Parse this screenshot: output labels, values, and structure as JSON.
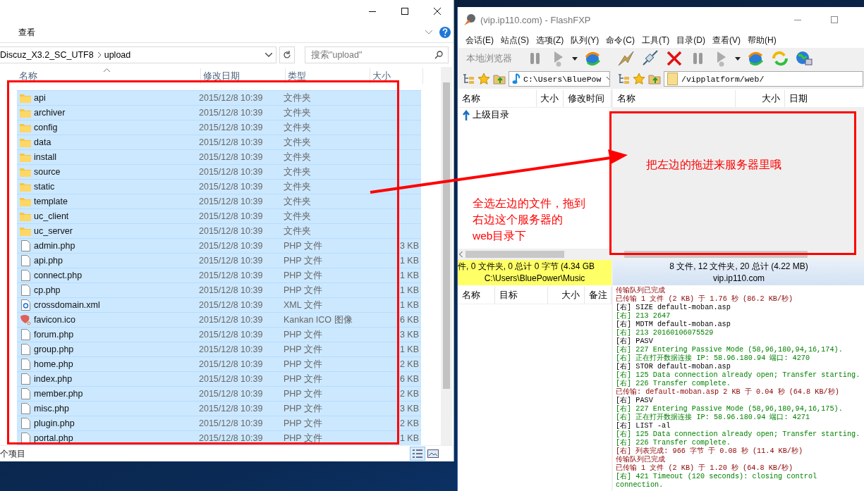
{
  "explorer": {
    "ribbon_tab": "查看",
    "breadcrumb": [
      "Discuz_X3.2_SC_UTF8",
      "upload"
    ],
    "search": {
      "placeholder": "搜索\"upload\""
    },
    "columns": [
      "名称",
      "修改日期",
      "类型",
      "大小"
    ],
    "rows": [
      {
        "name": "api",
        "date": "2015/12/8 10:39",
        "type": "文件夹",
        "kind": "folder",
        "selected": true
      },
      {
        "name": "archiver",
        "date": "2015/12/8 10:39",
        "type": "文件夹",
        "kind": "folder",
        "selected": true
      },
      {
        "name": "config",
        "date": "2015/12/8 10:39",
        "type": "文件夹",
        "kind": "folder",
        "selected": true
      },
      {
        "name": "data",
        "date": "2015/12/8 10:39",
        "type": "文件夹",
        "kind": "folder",
        "selected": true
      },
      {
        "name": "install",
        "date": "2015/12/8 10:39",
        "type": "文件夹",
        "kind": "folder",
        "selected": true
      },
      {
        "name": "source",
        "date": "2015/12/8 10:39",
        "type": "文件夹",
        "kind": "folder",
        "selected": true
      },
      {
        "name": "static",
        "date": "2015/12/8 10:39",
        "type": "文件夹",
        "kind": "folder",
        "selected": true
      },
      {
        "name": "template",
        "date": "2015/12/8 10:39",
        "type": "文件夹",
        "kind": "folder",
        "selected": true
      },
      {
        "name": "uc_client",
        "date": "2015/12/8 10:39",
        "type": "文件夹",
        "kind": "folder",
        "selected": true
      },
      {
        "name": "uc_server",
        "date": "2015/12/8 10:39",
        "type": "文件夹",
        "kind": "folder",
        "selected": true
      },
      {
        "name": "admin.php",
        "date": "2015/12/8 10:39",
        "type": "PHP 文件",
        "size": "3 KB",
        "kind": "file",
        "selected": true
      },
      {
        "name": "api.php",
        "date": "2015/12/8 10:39",
        "type": "PHP 文件",
        "size": "1 KB",
        "kind": "file",
        "selected": true
      },
      {
        "name": "connect.php",
        "date": "2015/12/8 10:39",
        "type": "PHP 文件",
        "size": "1 KB",
        "kind": "file",
        "selected": true
      },
      {
        "name": "cp.php",
        "date": "2015/12/8 10:39",
        "type": "PHP 文件",
        "size": "1 KB",
        "kind": "file",
        "selected": true
      },
      {
        "name": "crossdomain.xml",
        "date": "2015/12/8 10:39",
        "type": "XML 文件",
        "size": "1 KB",
        "kind": "xml",
        "selected": true
      },
      {
        "name": "favicon.ico",
        "date": "2015/12/8 10:39",
        "type": "Kankan ICO 图像",
        "size": "6 KB",
        "kind": "image",
        "selected": true
      },
      {
        "name": "forum.php",
        "date": "2015/12/8 10:39",
        "type": "PHP 文件",
        "size": "3 KB",
        "kind": "file",
        "selected": true
      },
      {
        "name": "group.php",
        "date": "2015/12/8 10:39",
        "type": "PHP 文件",
        "size": "1 KB",
        "kind": "file",
        "selected": true
      },
      {
        "name": "home.php",
        "date": "2015/12/8 10:39",
        "type": "PHP 文件",
        "size": "2 KB",
        "kind": "file",
        "selected": true
      },
      {
        "name": "index.php",
        "date": "2015/12/8 10:39",
        "type": "PHP 文件",
        "size": "6 KB",
        "kind": "file",
        "selected": true
      },
      {
        "name": "member.php",
        "date": "2015/12/8 10:39",
        "type": "PHP 文件",
        "size": "2 KB",
        "kind": "file",
        "selected": true
      },
      {
        "name": "misc.php",
        "date": "2015/12/8 10:39",
        "type": "PHP 文件",
        "size": "3 KB",
        "kind": "file",
        "selected": true
      },
      {
        "name": "plugin.php",
        "date": "2015/12/8 10:39",
        "type": "PHP 文件",
        "size": "2 KB",
        "kind": "file",
        "selected": true
      },
      {
        "name": "portal.php",
        "date": "2015/12/8 10:39",
        "type": "PHP 文件",
        "size": "1 KB",
        "kind": "file",
        "selected": true
      }
    ],
    "status_bar": "个项目"
  },
  "flashfxp": {
    "title": "(vip.ip110.com) - FlashFXP",
    "menu": [
      "会话(E)",
      "站点(S)",
      "选项(Z)",
      "队列(Y)",
      "命令(C)",
      "工具(T)",
      "目录(D)",
      "查看(V)",
      "帮助(H)"
    ],
    "local_label": "本地浏览器",
    "local": {
      "path": "C:\\Users\\BluePow",
      "columns": [
        "名称",
        "大小",
        "修改时间"
      ],
      "items": [
        "上级目录"
      ],
      "status": [
        "件, 0 文件夹, 0 总计 0 字节 (4.34 GB",
        "C:\\Users\\BluePower\\Music"
      ]
    },
    "remote": {
      "path": "/vipplatform/web/",
      "columns": [
        "名称",
        "大小",
        "日期"
      ],
      "status": [
        "8 文件, 12 文件夹, 20 总计 (4.22 MB)",
        "vip.ip110.com"
      ]
    },
    "queue_columns": [
      "名称",
      "目标",
      "大小",
      "备注"
    ],
    "log": [
      {
        "kind": "status",
        "text": "传输队列已完成"
      },
      {
        "kind": "status",
        "text": "已传输 1 文件 (2 KB) 于 1.76 秒 (86.2 KB/秒)"
      },
      {
        "kind": "command",
        "text": "[右] SIZE default-moban.asp"
      },
      {
        "kind": "reply",
        "text": "[右] 213 2647"
      },
      {
        "kind": "command",
        "text": "[右] MDTM default-moban.asp"
      },
      {
        "kind": "reply",
        "text": "[右] 213 20160106075529"
      },
      {
        "kind": "command",
        "text": "[右] PASV"
      },
      {
        "kind": "reply",
        "text": "[右] 227 Entering Passive Mode (58,96,180,94,16,174)."
      },
      {
        "kind": "reply",
        "text": "[右] 正在打开数据连接 IP: 58.96.180.94 端口: 4270"
      },
      {
        "kind": "command",
        "text": "[右] STOR default-moban.asp"
      },
      {
        "kind": "reply",
        "text": "[右] 125 Data connection already open; Transfer starting."
      },
      {
        "kind": "reply",
        "text": "[右] 226 Transfer complete."
      },
      {
        "kind": "status",
        "text": "已传输: default-moban.asp 2 KB 于 0.04 秒 (64.8 KB/秒)"
      },
      {
        "kind": "command",
        "text": "[右] PASV"
      },
      {
        "kind": "reply",
        "text": "[右] 227 Entering Passive Mode (58,96,180,94,16,175)."
      },
      {
        "kind": "reply",
        "text": "[右] 正在打开数据连接 IP: 58.96.180.94 端口: 4271"
      },
      {
        "kind": "command",
        "text": "[右] LIST -al"
      },
      {
        "kind": "reply",
        "text": "[右] 125 Data connection already open; Transfer starting."
      },
      {
        "kind": "reply",
        "text": "[右] 226 Transfer complete."
      },
      {
        "kind": "status",
        "text": "[右] 列表完成: 966 字节 于 0.08 秒 (11.4 KB/秒)"
      },
      {
        "kind": "status",
        "text": "传输队列已完成"
      },
      {
        "kind": "status",
        "text": "已传输 1 文件 (2 KB) 于 1.20 秒 (64.8 KB/秒)"
      },
      {
        "kind": "reply",
        "text": "[右] 421 Timeout (120 seconds): closing control"
      },
      {
        "kind": "reply",
        "text": "connection."
      }
    ]
  },
  "annotations": {
    "drop_hint": "把左边的拖进来服务器里哦",
    "instruction": [
      "全选左边的文件，拖到",
      "右边这个服务器的",
      "web目录下"
    ]
  }
}
